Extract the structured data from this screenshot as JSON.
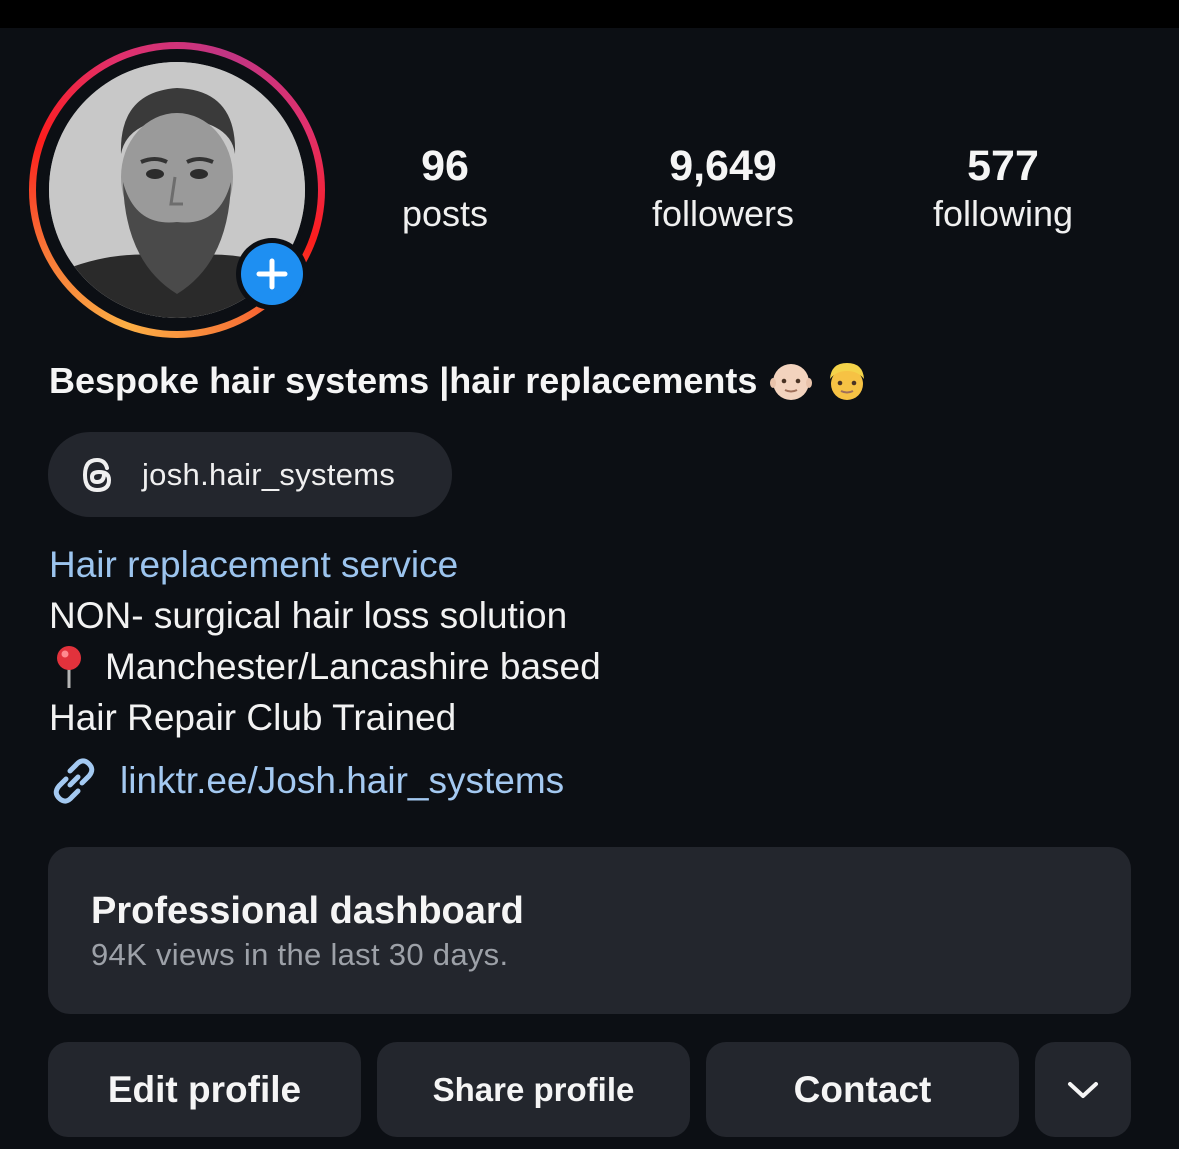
{
  "profile": {
    "stats": {
      "posts": {
        "value": "96",
        "label": "posts"
      },
      "followers": {
        "value": "9,649",
        "label": "followers"
      },
      "following": {
        "value": "577",
        "label": "following"
      }
    },
    "name": "Bespoke hair systems |hair replacements",
    "name_emojis": [
      "bald-man-emoji",
      "blond-man-emoji"
    ],
    "threads_handle": "josh.hair_systems",
    "category": "Hair replacement service",
    "bio_lines": [
      "NON- surgical hair loss solution",
      "Manchester/Lancashire based",
      "Hair Repair Club Trained"
    ],
    "bio_line_icons": [
      "",
      "pin-emoji",
      ""
    ],
    "link": "linktr.ee/Josh.hair_systems"
  },
  "dashboard": {
    "title": "Professional dashboard",
    "subtitle": "94K views in the last 30 days."
  },
  "actions": {
    "edit": "Edit profile",
    "share": "Share profile",
    "contact": "Contact",
    "more_icon": "chevron-down-icon"
  },
  "colors": {
    "background": "#0c0f14",
    "card": "#23262d",
    "link": "#a4c9f1",
    "category": "#9cc4ee",
    "add_badge": "#1e8ff2"
  }
}
